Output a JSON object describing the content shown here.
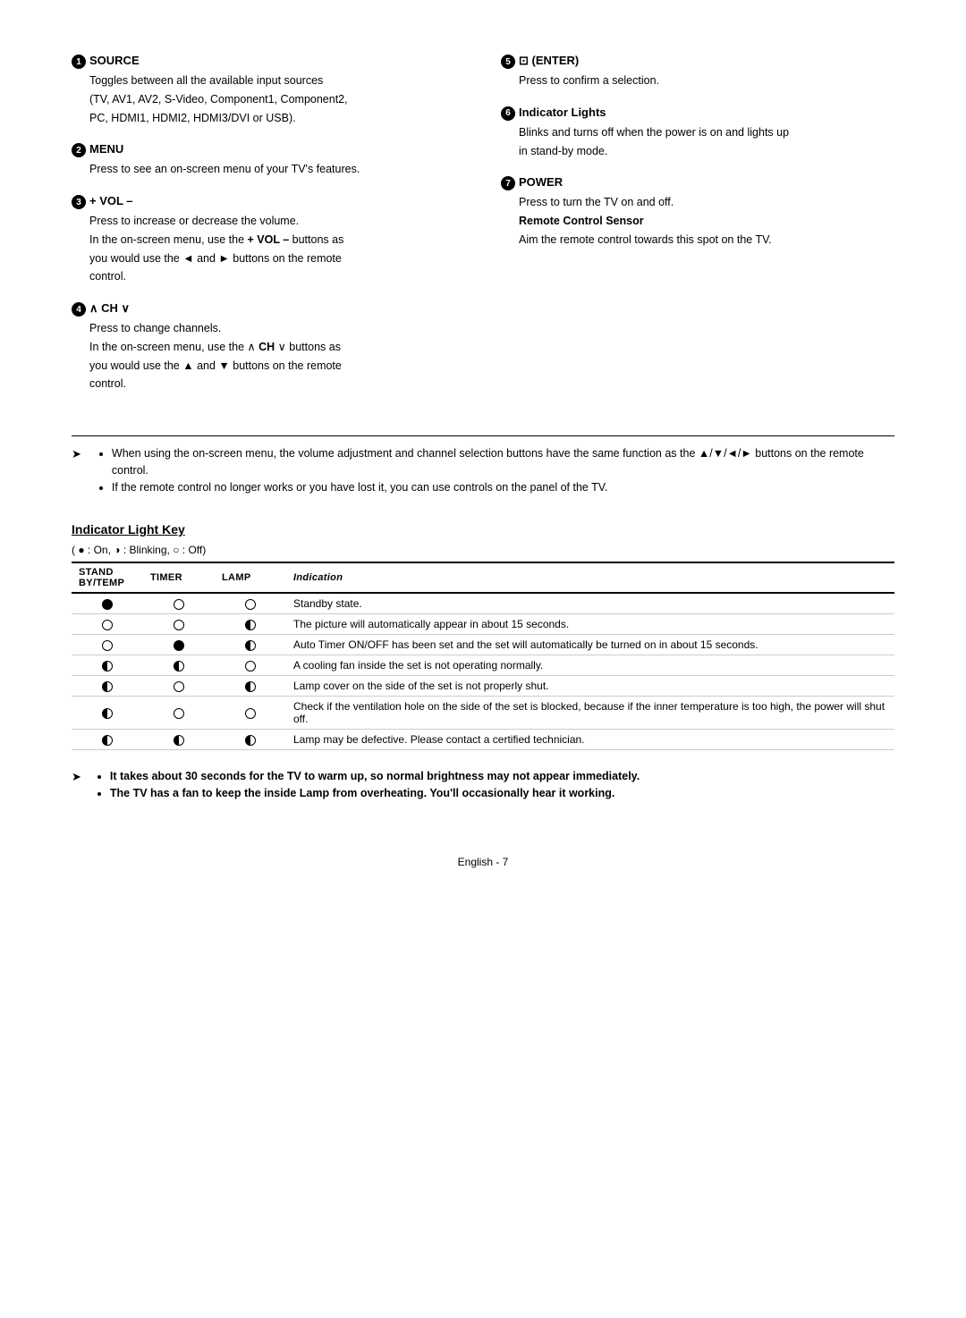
{
  "page": {
    "footer": "English - 7"
  },
  "left_column": {
    "sections": [
      {
        "id": "1",
        "title": "SOURCE",
        "body": [
          "Toggles between all the available input sources",
          "(TV, AV1, AV2, S-Video, Component1, Component2,",
          "PC, HDMI1, HDMI2, HDMI3/DVI or USB)."
        ]
      },
      {
        "id": "2",
        "title": "MENU",
        "body": [
          "Press to see an on-screen menu of your TV's features."
        ]
      },
      {
        "id": "3",
        "title": "+ VOL –",
        "body": [
          "Press to increase or decrease the volume.",
          "In the on-screen menu, use the + VOL – buttons as",
          "you would use the ◄ and ► buttons on the remote",
          "control."
        ]
      },
      {
        "id": "4",
        "title": "∧ CH ∨",
        "body": [
          "Press to change channels.",
          "In the on-screen menu, use the ∧ CH ∨ buttons as",
          "you would use the ▲ and ▼ buttons on the remote",
          "control."
        ]
      }
    ]
  },
  "right_column": {
    "sections": [
      {
        "id": "5",
        "title": "⊡ (ENTER)",
        "body": [
          "Press to confirm a selection."
        ]
      },
      {
        "id": "6",
        "title": "Indicator Lights",
        "body": [
          "Blinks and turns off when the power is on and lights up",
          "in stand-by mode."
        ]
      },
      {
        "id": "7",
        "title": "POWER",
        "body": [
          "Press to turn the TV on and off.",
          "Remote Control Sensor",
          "Aim the remote control towards this spot on the TV."
        ],
        "bold_item": "Remote Control Sensor"
      }
    ]
  },
  "notes": {
    "arrow_symbol": "➤",
    "items": [
      "When using the on-screen menu, the volume adjustment and channel selection buttons have the same function as the ▲/▼/◄/► buttons on the remote control.",
      "If the remote control no longer works or you have lost it, you can use controls on the panel of the TV."
    ]
  },
  "indicator_light_key": {
    "title": "Indicator Light Key",
    "legend": "( ● : On, ◑ : Blinking, ○ : Off)",
    "table": {
      "headers": [
        "Stand By/Temp",
        "Timer",
        "Lamp",
        "Indication"
      ],
      "rows": [
        {
          "standby": "on",
          "timer": "off",
          "lamp": "off",
          "indication": "Standby state."
        },
        {
          "standby": "off",
          "timer": "off",
          "lamp": "blink",
          "indication": "The picture will automatically appear in about 15 seconds."
        },
        {
          "standby": "off",
          "timer": "on",
          "lamp": "blink",
          "indication": "Auto Timer ON/OFF has been set and the set will automatically be turned on in about 15 seconds."
        },
        {
          "standby": "blink",
          "timer": "blink",
          "lamp": "off",
          "indication": "A cooling fan inside the set is not operating normally."
        },
        {
          "standby": "blink",
          "timer": "off",
          "lamp": "blink",
          "indication": "Lamp cover on the side of the set is not properly shut."
        },
        {
          "standby": "blink",
          "timer": "off",
          "lamp": "off",
          "indication": "Check if the ventilation hole on the side of the set is blocked, because if the inner temperature is too high, the power will shut off."
        },
        {
          "standby": "blink",
          "timer": "blink",
          "lamp": "blink",
          "indication": "Lamp may be defective. Please contact a certified technician."
        }
      ]
    }
  },
  "footer_notes": {
    "items": [
      "It takes about 30 seconds for the TV to warm up, so normal brightness may not appear immediately.",
      "The TV has a fan to keep the inside Lamp from overheating. You'll occasionally hear it working."
    ]
  }
}
